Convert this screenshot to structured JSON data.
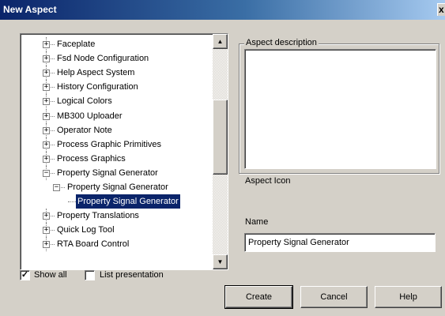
{
  "window": {
    "title": "New Aspect",
    "close_icon": "close-icon",
    "close_glyph": "x"
  },
  "tree": {
    "items": [
      {
        "label": "Faceplate",
        "expander": "+",
        "level": 0,
        "selected": false
      },
      {
        "label": "Fsd Node Configuration",
        "expander": "+",
        "level": 0,
        "selected": false
      },
      {
        "label": "Help Aspect System",
        "expander": "+",
        "level": 0,
        "selected": false
      },
      {
        "label": "History Configuration",
        "expander": "+",
        "level": 0,
        "selected": false
      },
      {
        "label": "Logical Colors",
        "expander": "+",
        "level": 0,
        "selected": false
      },
      {
        "label": "MB300 Uploader",
        "expander": "+",
        "level": 0,
        "selected": false
      },
      {
        "label": "Operator Note",
        "expander": "+",
        "level": 0,
        "selected": false
      },
      {
        "label": "Process Graphic Primitives",
        "expander": "+",
        "level": 0,
        "selected": false
      },
      {
        "label": "Process Graphics",
        "expander": "+",
        "level": 0,
        "selected": false
      },
      {
        "label": "Property Signal Generator",
        "expander": "-",
        "level": 0,
        "selected": false
      },
      {
        "label": "Property Signal Generator",
        "expander": "-",
        "level": 1,
        "selected": false
      },
      {
        "label": "Property Signal Generator",
        "expander": "",
        "level": 2,
        "selected": true
      },
      {
        "label": "Property Translations",
        "expander": "+",
        "level": 0,
        "selected": false
      },
      {
        "label": "Quick Log Tool",
        "expander": "+",
        "level": 0,
        "selected": false
      },
      {
        "label": "RTA Board Control",
        "expander": "+",
        "level": 0,
        "selected": false
      }
    ],
    "scroll_position": 0.45
  },
  "description": {
    "legend": "Aspect description",
    "value": ""
  },
  "aspect_icon_label": "Aspect Icon",
  "name": {
    "label": "Name",
    "value": "Property Signal Generator"
  },
  "options": {
    "show_all": {
      "label": "Show all",
      "checked": true,
      "mark": "✓"
    },
    "list_presentation": {
      "label": "List presentation",
      "checked": false,
      "mark": ""
    }
  },
  "buttons": {
    "create": "Create",
    "cancel": "Cancel",
    "help": "Help"
  },
  "colors": {
    "selection": "#0a246a",
    "dialog_bg": "#d4d0c8",
    "title_start": "#0a246a",
    "title_end": "#a6caf0"
  }
}
